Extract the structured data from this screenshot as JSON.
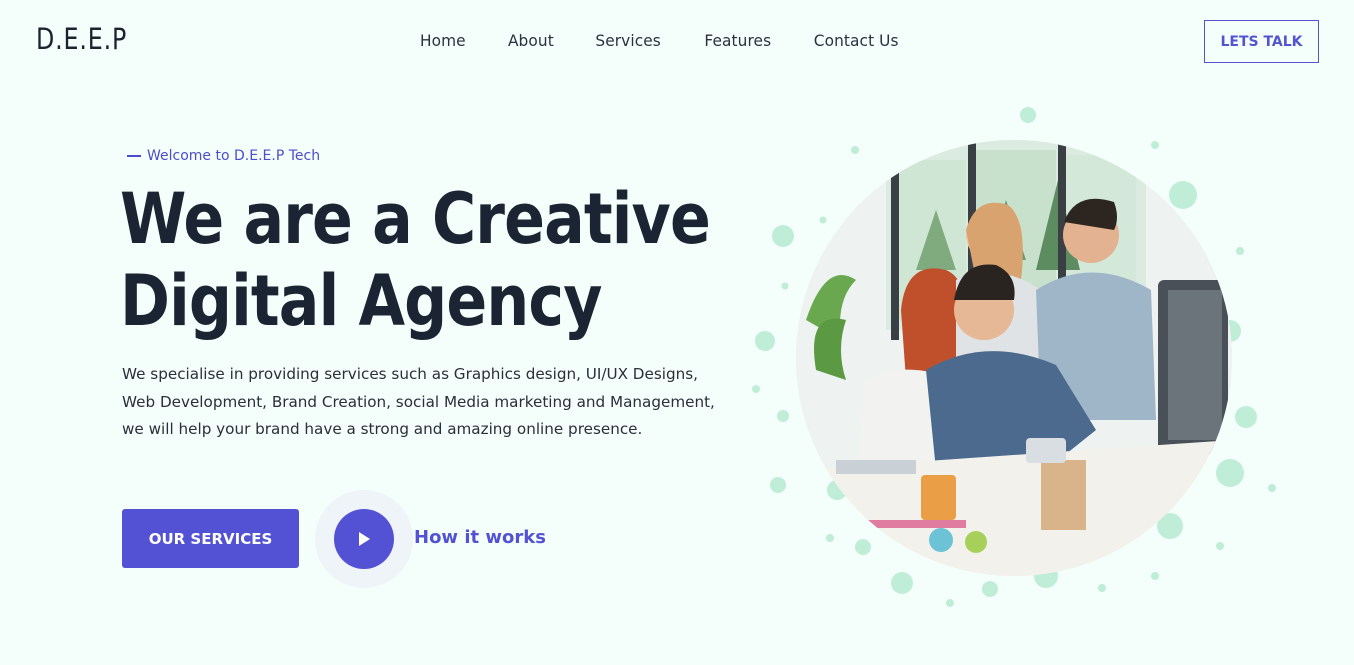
{
  "header": {
    "logo": "D.E.E.P",
    "nav": [
      "Home",
      "About",
      "Services",
      "Features",
      "Contact Us"
    ],
    "cta_label": "LETS TALK"
  },
  "hero": {
    "eyebrow": "Welcome to D.E.E.P Tech",
    "title_line1": "We are a Creative",
    "title_line2": "Digital Agency",
    "description": "We specialise in providing services such as Graphics design, UI/UX Designs, Web Development, Brand Creation, social Media marketing and Management, we will help your brand have a strong and amazing online presence.",
    "primary_button": "OUR SERVICES",
    "video_link": "How it works"
  },
  "visual": {
    "image_subject": "team-working-at-computer-photo",
    "decoration": "mint-bubbles"
  },
  "colors": {
    "background": "#f4fffb",
    "accent": "#5452d4",
    "heading": "#1b2432",
    "bubble": "#bfedd8"
  }
}
